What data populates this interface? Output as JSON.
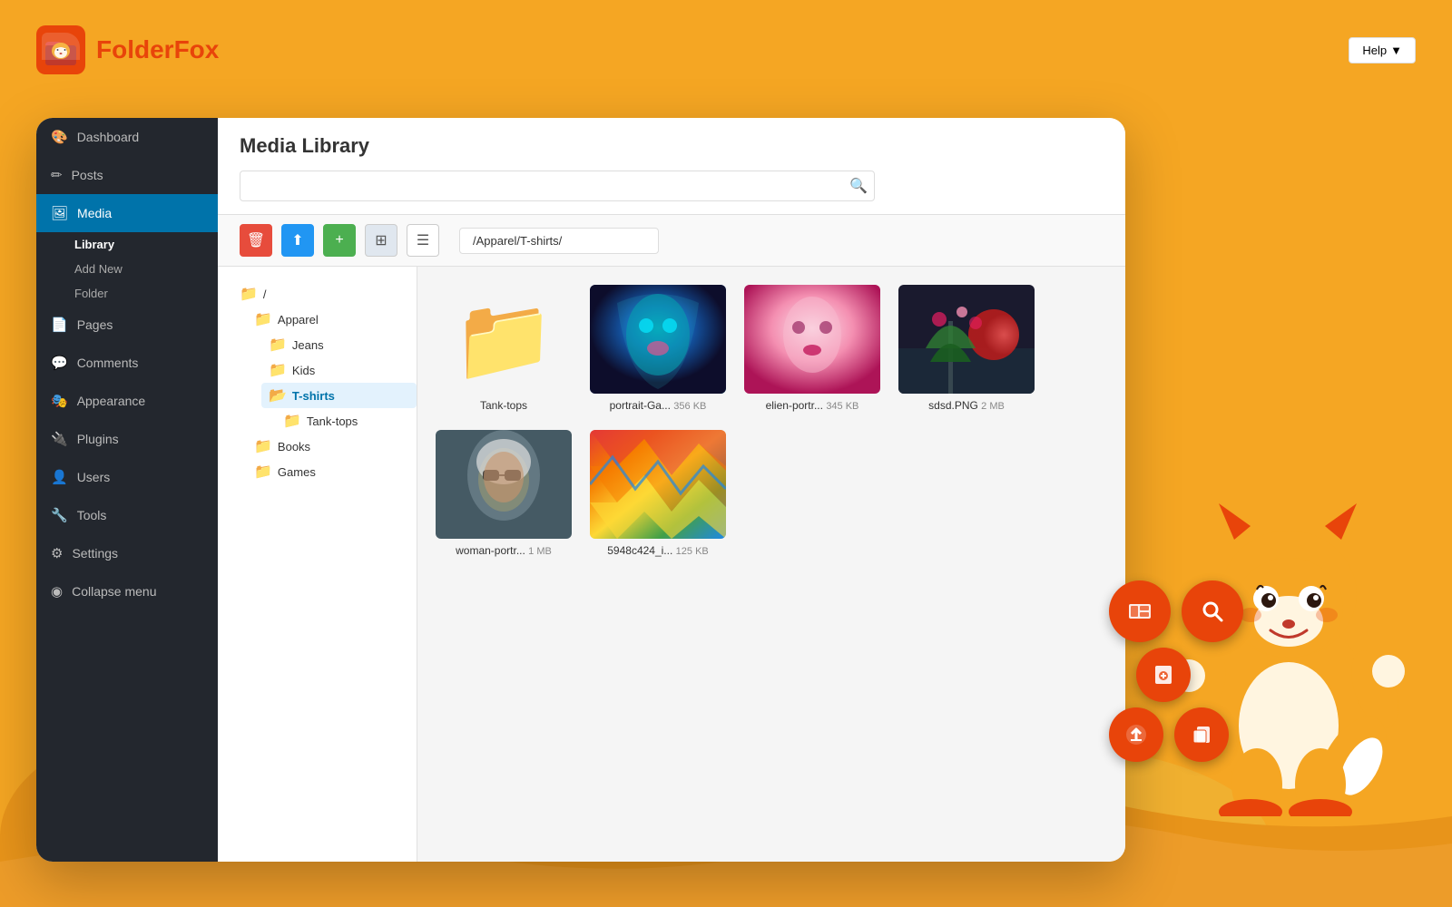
{
  "app": {
    "name": "FolderFox",
    "name_part1": "Folder",
    "name_part2": "Fox"
  },
  "header": {
    "help_btn": "Help",
    "help_arrow": "▼"
  },
  "sidebar": {
    "items": [
      {
        "id": "dashboard",
        "label": "Dashboard",
        "icon": "🎨",
        "active": false
      },
      {
        "id": "posts",
        "label": "Posts",
        "icon": "📝",
        "active": false
      },
      {
        "id": "media",
        "label": "Media",
        "icon": "🖼",
        "active": true
      },
      {
        "id": "pages",
        "label": "Pages",
        "icon": "📄",
        "active": false
      },
      {
        "id": "comments",
        "label": "Comments",
        "icon": "💬",
        "active": false
      },
      {
        "id": "appearance",
        "label": "Appearance",
        "icon": "🎭",
        "active": false
      },
      {
        "id": "plugins",
        "label": "Plugins",
        "icon": "🔌",
        "active": false
      },
      {
        "id": "users",
        "label": "Users",
        "icon": "👤",
        "active": false
      },
      {
        "id": "tools",
        "label": "Tools",
        "icon": "🔧",
        "active": false
      },
      {
        "id": "settings",
        "label": "Settings",
        "icon": "⚙",
        "active": false
      },
      {
        "id": "collapse",
        "label": "Collapse menu",
        "icon": "◉",
        "active": false
      }
    ],
    "sub_items": [
      {
        "id": "library",
        "label": "Library",
        "parent": "media",
        "active": true
      },
      {
        "id": "add-new",
        "label": "Add New",
        "parent": "media",
        "active": false
      },
      {
        "id": "folder",
        "label": "Folder",
        "parent": "media",
        "active": false
      }
    ]
  },
  "main": {
    "title": "Media Library",
    "search_placeholder": "",
    "path_value": "/Apparel/T-shirts/"
  },
  "toolbar": {
    "delete_btn": "🗑",
    "upload_btn": "☁",
    "add_btn": "+",
    "grid_view_btn": "⊞",
    "list_view_btn": "☰"
  },
  "folder_tree": {
    "items": [
      {
        "id": "root",
        "label": "/",
        "indent": 0,
        "selected": false
      },
      {
        "id": "apparel",
        "label": "Apparel",
        "indent": 1,
        "selected": false
      },
      {
        "id": "jeans",
        "label": "Jeans",
        "indent": 2,
        "selected": false
      },
      {
        "id": "kids",
        "label": "Kids",
        "indent": 2,
        "selected": false
      },
      {
        "id": "t-shirts",
        "label": "T-shirts",
        "indent": 2,
        "selected": true
      },
      {
        "id": "tank-tops-sub",
        "label": "Tank-tops",
        "indent": 3,
        "selected": false
      },
      {
        "id": "books",
        "label": "Books",
        "indent": 1,
        "selected": false
      },
      {
        "id": "games",
        "label": "Games",
        "indent": 1,
        "selected": false
      }
    ]
  },
  "media_items": [
    {
      "id": "tank-tops",
      "type": "folder",
      "label": "Tank-tops",
      "size": ""
    },
    {
      "id": "portrait-ga",
      "type": "image",
      "label": "portrait-Ga...",
      "size": "356 KB",
      "style": "img-face-blue"
    },
    {
      "id": "elien-portr",
      "type": "image",
      "label": "elien-portr...",
      "size": "345 KB",
      "style": "img-face-pink"
    },
    {
      "id": "sdsd-png",
      "type": "image",
      "label": "sdsd.PNG",
      "size": "2 MB",
      "style": "img-tree-red"
    },
    {
      "id": "woman-portr",
      "type": "image",
      "label": "woman-portr...",
      "size": "1 MB",
      "style": "img-woman"
    },
    {
      "id": "5948c424",
      "type": "image",
      "label": "5948c424_i...",
      "size": "125 KB",
      "style": "img-colorful"
    }
  ],
  "action_buttons": [
    {
      "id": "gallery",
      "icon": "🖼",
      "large": true
    },
    {
      "id": "search",
      "icon": "🔍",
      "large": true
    },
    {
      "id": "add-media",
      "icon": "➕",
      "large": false
    },
    {
      "id": "upload",
      "icon": "⬆",
      "large": false
    },
    {
      "id": "copy",
      "icon": "📋",
      "large": false
    }
  ]
}
